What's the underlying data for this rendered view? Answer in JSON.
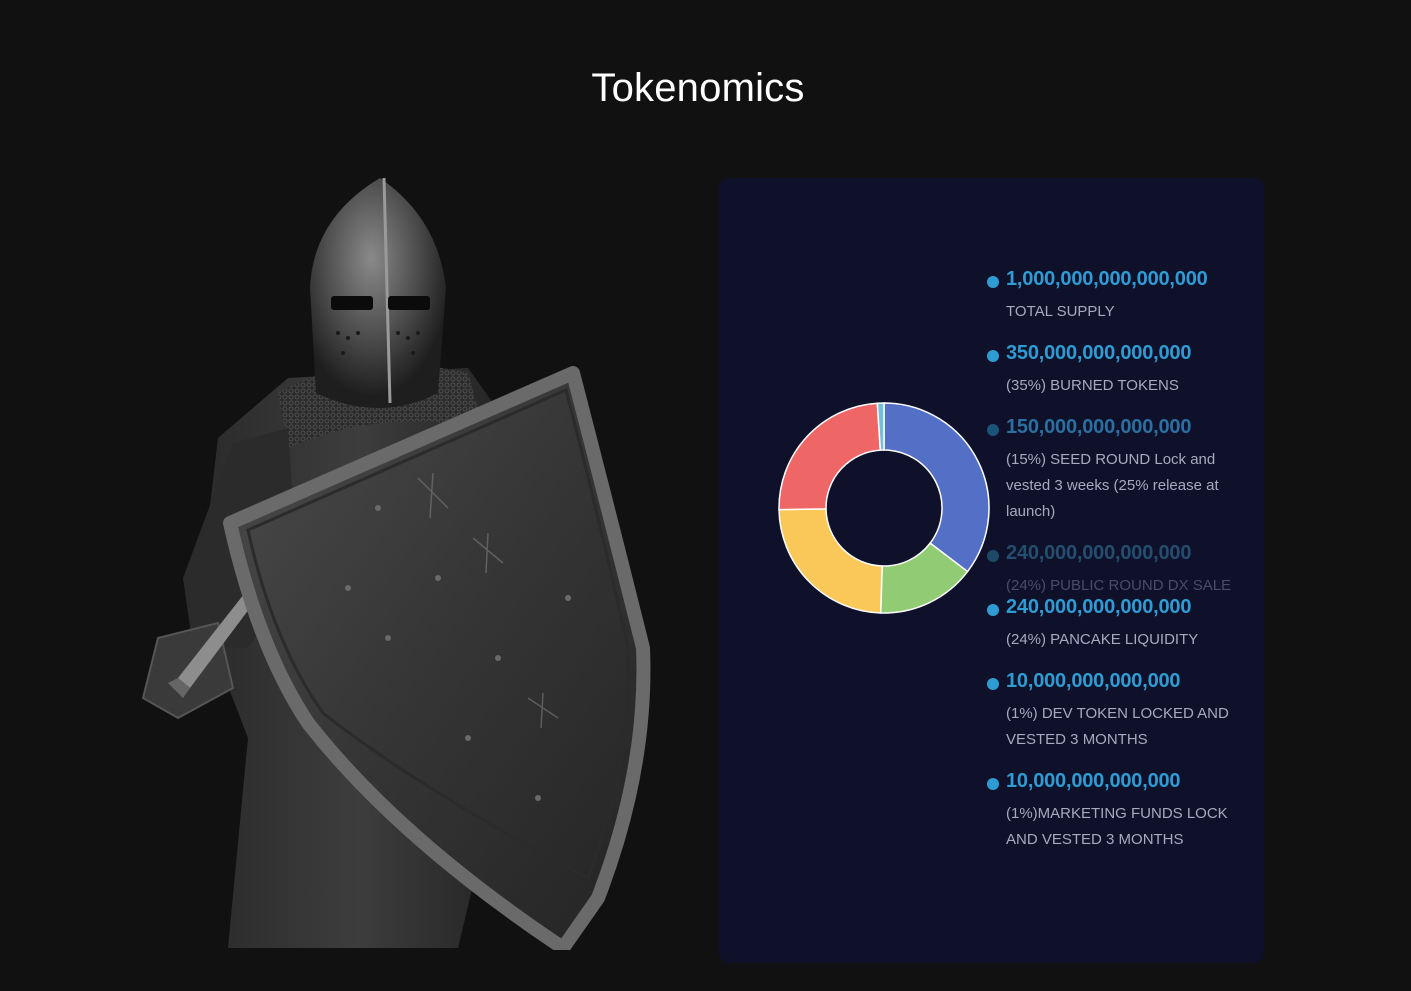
{
  "section": {
    "title": "Tokenomics"
  },
  "colors": {
    "page_background": "#111111",
    "card_background": "#0f112b",
    "accent_blue": "#2f9bd3",
    "description_text": "#a7a9bd"
  },
  "legend": [
    {
      "amount": "1,000,000,000,000,000",
      "label": "TOTAL SUPPLY"
    },
    {
      "amount": "350,000,000,000,000",
      "label": "(35%) BURNED TOKENS"
    },
    {
      "amount": "150,000,000,000,000",
      "label": "(15%) SEED ROUND Lock and vested 3 weeks (25% release at launch)"
    },
    {
      "amount": "240,000,000,000,000",
      "label": "(24%) PUBLIC ROUND DX SALE"
    },
    {
      "amount": "240,000,000,000,000",
      "label": "(24%) PANCAKE LIQUIDITY"
    },
    {
      "amount": "10,000,000,000,000",
      "label": "(1%) DEV TOKEN LOCKED AND VESTED 3 MONTHS"
    },
    {
      "amount": "10,000,000,000,000",
      "label": "(1%)MARKETING FUNDS LOCK AND VESTED 3 MONTHS"
    }
  ],
  "chart_data": {
    "type": "pie",
    "categories": [
      "",
      "",
      "",
      "",
      ""
    ],
    "values": [
      35,
      15,
      24,
      24,
      1
    ],
    "colors": [
      "#5470c6",
      "#91cc75",
      "#fac858",
      "#ee6666",
      "#73c0de"
    ],
    "start_angle_deg": 0,
    "donut": true
  },
  "image": {
    "icon": "armored-knight-with-shield-image"
  }
}
